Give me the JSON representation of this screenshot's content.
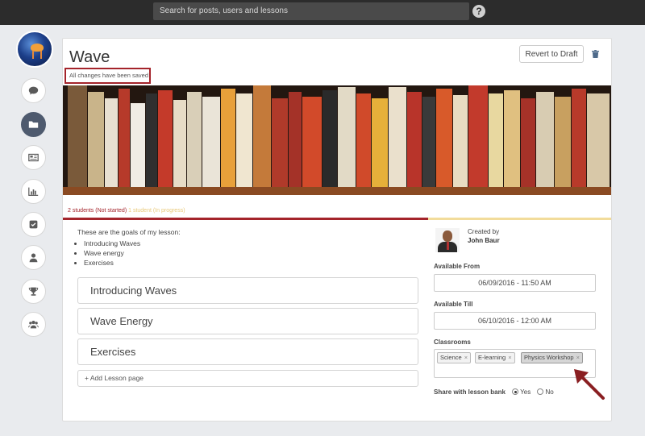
{
  "topbar": {
    "search_placeholder": "Search for posts, users and lessons",
    "help_icon_label": "?"
  },
  "sidebar": {
    "items": [
      {
        "name": "comments",
        "icon": "speech-bubble-icon"
      },
      {
        "name": "lessons",
        "icon": "folder-icon",
        "active": true
      },
      {
        "name": "news",
        "icon": "newspaper-icon"
      },
      {
        "name": "reports",
        "icon": "bar-chart-icon"
      },
      {
        "name": "tasks",
        "icon": "checkbox-icon"
      },
      {
        "name": "profile",
        "icon": "user-icon"
      },
      {
        "name": "achievements",
        "icon": "trophy-icon"
      },
      {
        "name": "groups",
        "icon": "group-icon"
      }
    ]
  },
  "lesson": {
    "title": "Wave",
    "save_status": "All changes have been saved",
    "revert_label": "Revert to Draft",
    "progress_not_started": "2 students (Not started)",
    "progress_in_progress": "1 student (In progress)",
    "goals_intro": "These are the goals of my lesson:",
    "goals": [
      "Introducing Waves",
      "Wave energy",
      "Exercises"
    ],
    "pages": [
      "Introducing Waves",
      "Wave Energy",
      "Exercises"
    ],
    "add_page_label": "+ Add Lesson page"
  },
  "details": {
    "created_by_label": "Created by",
    "creator_name": "John Baur",
    "available_from_label": "Available From",
    "available_from": "06/09/2016 - 11:50 AM",
    "available_till_label": "Available Till",
    "available_till": "06/10/2016 - 12:00 AM",
    "classrooms_label": "Classrooms",
    "classrooms": [
      "Science",
      "E-learning",
      "Physics Workshop"
    ],
    "remove_glyph": "×",
    "share_label": "Share with lesson bank",
    "share_yes": "Yes",
    "share_no": "No",
    "share_selected": "Yes"
  },
  "colors": {
    "accent_red": "#a4242b",
    "accent_yellow": "#f2dc9b",
    "active_nav": "#4e5a6e",
    "topbar": "#2c2c2c"
  }
}
